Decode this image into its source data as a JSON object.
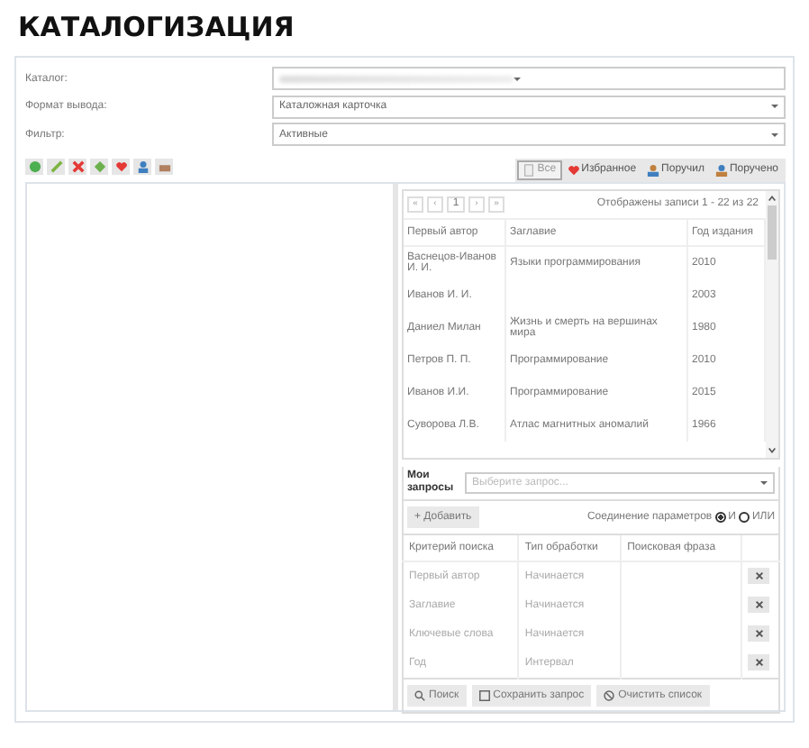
{
  "title": "КАТАЛОГИЗАЦИЯ",
  "form": [
    {
      "label": "Каталог:"
    },
    {
      "label": "Формат вывода:",
      "value": "Каталожная карточка"
    },
    {
      "label": "Фильтр:",
      "value": "Активные"
    }
  ],
  "toolbar": [
    {
      "kind": "add"
    },
    {
      "kind": "edit"
    },
    {
      "kind": "delete"
    },
    {
      "kind": "copy"
    },
    {
      "kind": "favorite"
    },
    {
      "kind": "user"
    },
    {
      "kind": "print"
    }
  ],
  "filters": [
    {
      "label": "Все",
      "selected": true
    },
    {
      "label": "Избранное",
      "selected": false
    },
    {
      "label": "Поручил",
      "selected": false
    },
    {
      "label": "Поручено",
      "selected": false
    }
  ],
  "pager": {
    "buttons": [
      {
        "label": "«",
        "selected": false
      },
      {
        "label": "‹",
        "selected": false
      },
      {
        "label": "1",
        "selected": true
      },
      {
        "label": "›",
        "selected": false
      },
      {
        "label": "»",
        "selected": false
      }
    ],
    "info": "Отображены записи 1 - 22 из 22"
  },
  "table": {
    "columns": [
      "Первый автор",
      "Заглавие",
      "Год издания"
    ],
    "rows": [
      [
        "Васнецов-Иванов И. И.",
        "Языки программирования",
        "2010"
      ],
      [
        "Иванов И. И.",
        "",
        "2003"
      ],
      [
        "Даниел Милан",
        "Жизнь и смерть на вершинах мира",
        "1980"
      ],
      [
        "Петров П. П.",
        "Программирование",
        "2010"
      ],
      [
        "Иванов И.И.",
        "Программирование",
        "2015"
      ],
      [
        "Суворова Л.В.",
        "Атлас магнитных аномалий",
        "1966"
      ]
    ]
  },
  "queries": {
    "label": "Мои запросы",
    "placeholder": "Выберите запрос..."
  },
  "add_button": "+ Добавить",
  "join": {
    "label": "Соединение параметров",
    "options": [
      {
        "label": "И",
        "selected": true
      },
      {
        "label": "ИЛИ",
        "selected": false
      }
    ]
  },
  "criteria": {
    "columns": [
      "Критерий поиска",
      "Тип обработки",
      "Поисковая фраза"
    ],
    "rows": [
      [
        "Первый автор",
        "Начинается",
        ""
      ],
      [
        "Заглавие",
        "Начинается",
        ""
      ],
      [
        "Ключевые слова",
        "Начинается",
        ""
      ],
      [
        "Год",
        "Интервал",
        ""
      ]
    ]
  },
  "actions": [
    {
      "label": "Поиск"
    },
    {
      "label": "Сохранить запрос"
    },
    {
      "label": "Очистить список"
    }
  ]
}
